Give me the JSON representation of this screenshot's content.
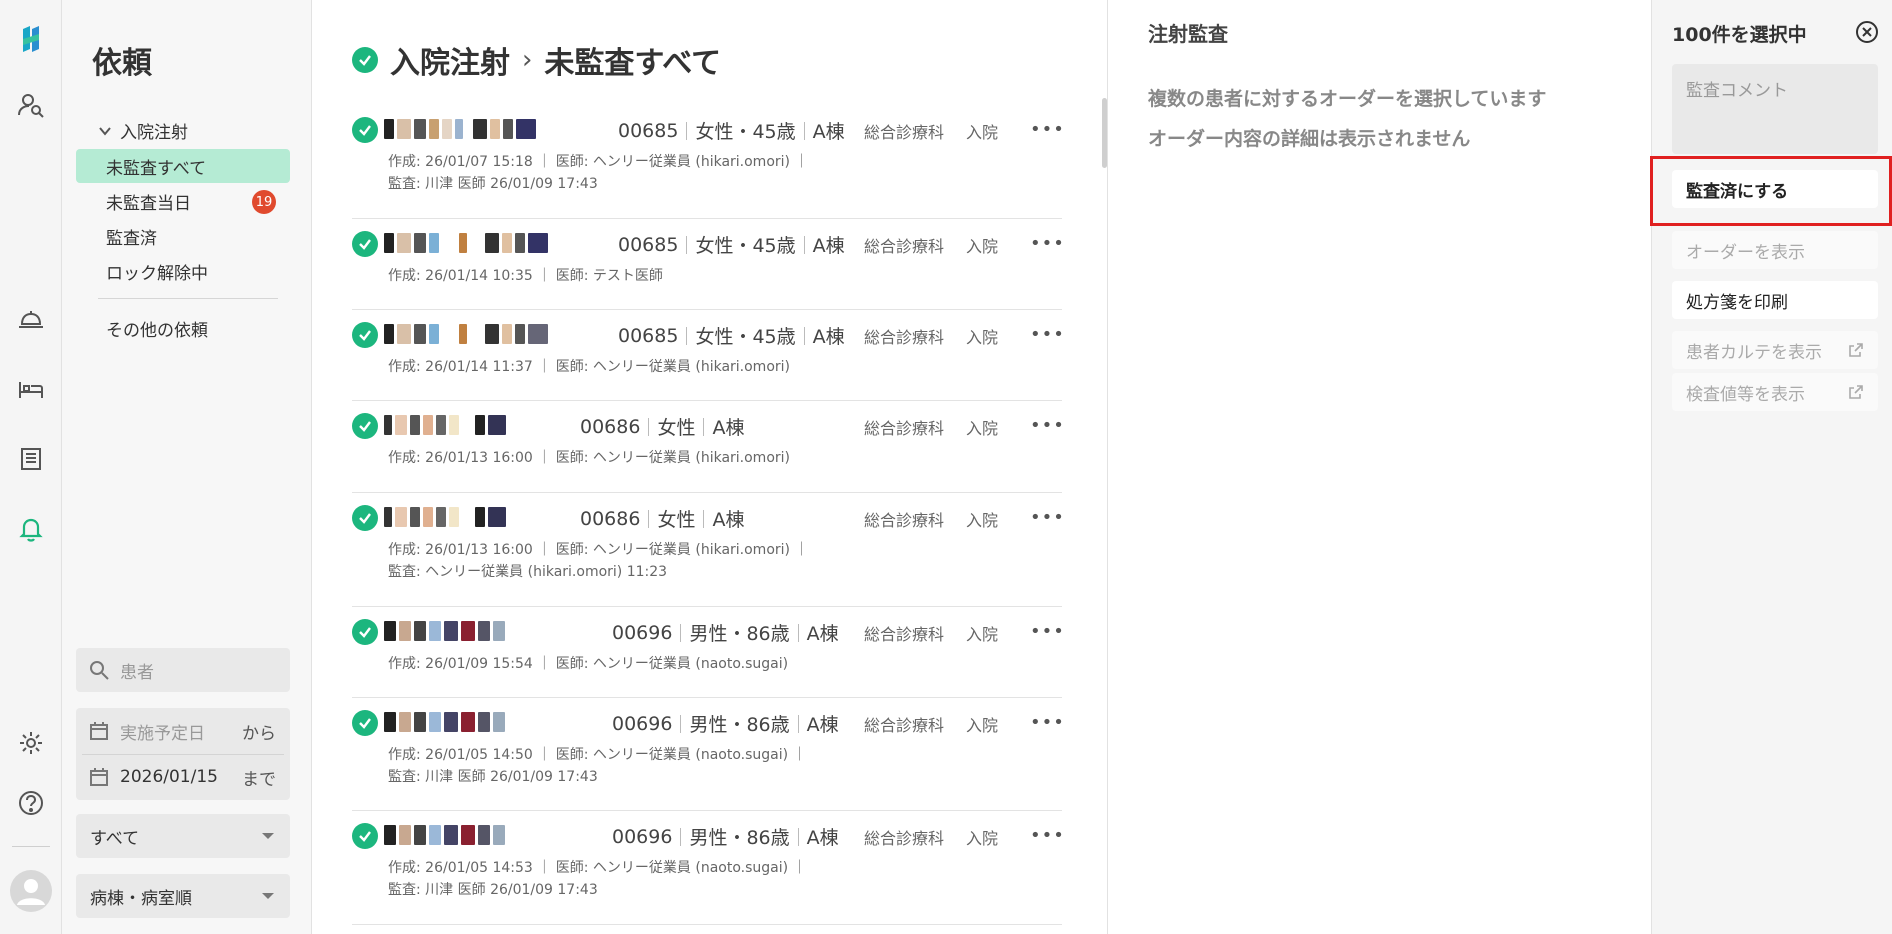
{
  "sidebar": {
    "title": "依頼",
    "group_label": "入院注射",
    "items": [
      {
        "label": "未監査すべて",
        "active": true
      },
      {
        "label": "未監査当日",
        "badge": "19"
      },
      {
        "label": "監査済"
      },
      {
        "label": "ロック解除中"
      }
    ],
    "other_label": "その他の依頼",
    "search_placeholder": "患者",
    "date_from_placeholder": "実施予定日",
    "date_from_suffix": "から",
    "date_to_value": "2026/01/15",
    "date_to_suffix": "まで",
    "filter_select": "すべて",
    "sort_select": "病棟・病室順"
  },
  "main": {
    "title_part1": "入院注射",
    "title_sep": "›",
    "title_part2": "未監査すべて",
    "rows": [
      {
        "id": "00685",
        "sex_age": "女性・45歳",
        "ward": "A棟",
        "dept": "総合診療科",
        "type": "入院",
        "meta1": "作成: 26/01/07 15:18 ｜ 医師: ヘンリー従業員 (hikari.omori) ｜",
        "meta2": "監査: 川津 医師 26/01/09 17:43"
      },
      {
        "id": "00685",
        "sex_age": "女性・45歳",
        "ward": "A棟",
        "dept": "総合診療科",
        "type": "入院",
        "meta1": "作成: 26/01/14 10:35 ｜ 医師: テスト医師",
        "meta2": ""
      },
      {
        "id": "00685",
        "sex_age": "女性・45歳",
        "ward": "A棟",
        "dept": "総合診療科",
        "type": "入院",
        "meta1": "作成: 26/01/14 11:37 ｜ 医師: ヘンリー従業員 (hikari.omori)",
        "meta2": ""
      },
      {
        "id": "00686",
        "sex_age": "女性",
        "ward": "A棟",
        "dept": "総合診療科",
        "type": "入院",
        "meta1": "作成: 26/01/13 16:00 ｜ 医師: ヘンリー従業員 (hikari.omori)",
        "meta2": ""
      },
      {
        "id": "00686",
        "sex_age": "女性",
        "ward": "A棟",
        "dept": "総合診療科",
        "type": "入院",
        "meta1": "作成: 26/01/13 16:00 ｜ 医師: ヘンリー従業員 (hikari.omori) ｜",
        "meta2": "監査: ヘンリー従業員 (hikari.omori) 11:23"
      },
      {
        "id": "00696",
        "sex_age": "男性・86歳",
        "ward": "A棟",
        "dept": "総合診療科",
        "type": "入院",
        "meta1": "作成: 26/01/09 15:54 ｜ 医師: ヘンリー従業員 (naoto.sugai)",
        "meta2": ""
      },
      {
        "id": "00696",
        "sex_age": "男性・86歳",
        "ward": "A棟",
        "dept": "総合診療科",
        "type": "入院",
        "meta1": "作成: 26/01/05 14:50 ｜ 医師: ヘンリー従業員 (naoto.sugai) ｜",
        "meta2": "監査: 川津 医師 26/01/09 17:43"
      },
      {
        "id": "00696",
        "sex_age": "男性・86歳",
        "ward": "A棟",
        "dept": "総合診療科",
        "type": "入院",
        "meta1": "作成: 26/01/05 14:53 ｜ 医師: ヘンリー従業員 (naoto.sugai) ｜",
        "meta2": "監査: 川津 医師 26/01/09 17:43"
      }
    ]
  },
  "detail": {
    "title": "注射監査",
    "message1": "複数の患者に対するオーダーを選択しています",
    "message2": "オーダー内容の詳細は表示されません"
  },
  "actions": {
    "title": "100件を選択中",
    "comment_placeholder": "監査コメント",
    "mark_audited": "監査済にする",
    "show_order": "オーダーを表示",
    "print_prescription": "処方箋を印刷",
    "show_chart": "患者カルテを表示",
    "show_tests": "検査値等を表示"
  },
  "colors": {
    "accent": "#1cb67e",
    "active_bg": "#b5ebd4",
    "badge": "#e04a2e",
    "highlight": "#e02020"
  }
}
